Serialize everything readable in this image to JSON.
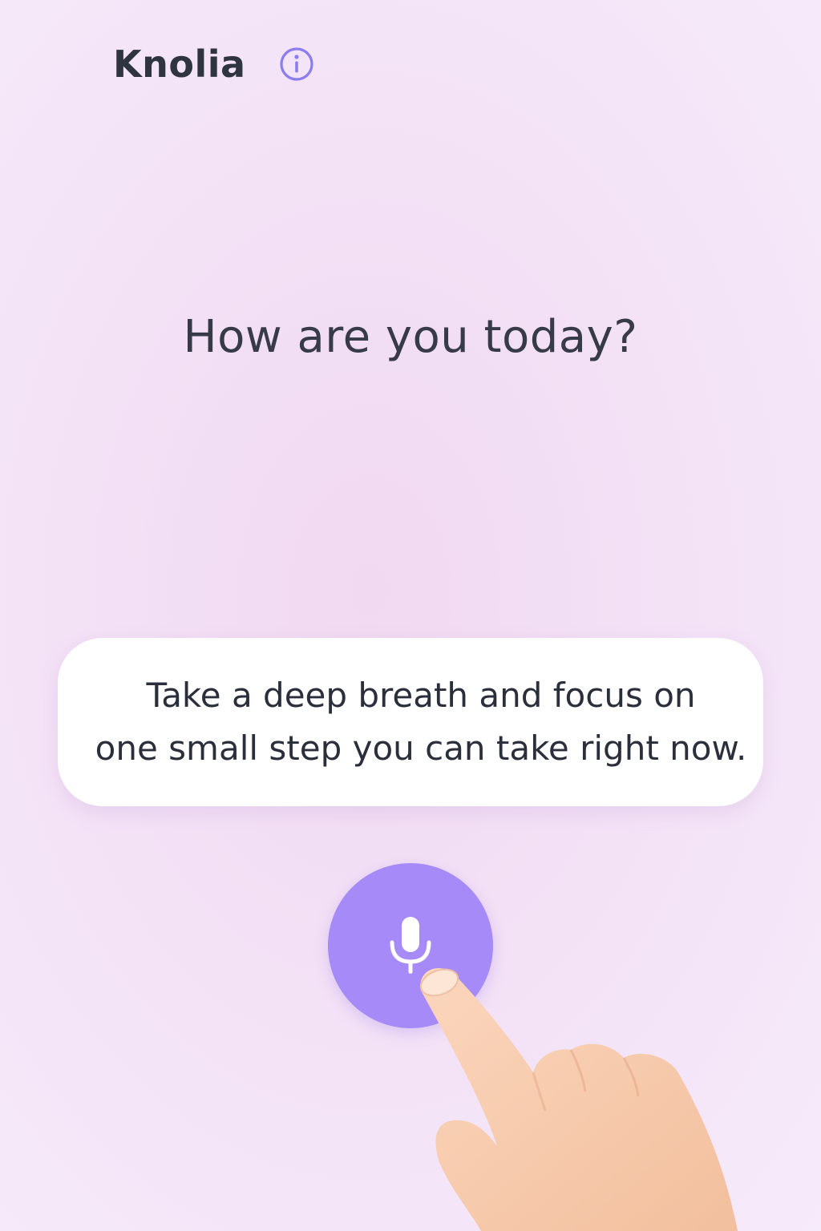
{
  "app": {
    "title": "Knolia"
  },
  "prompt": {
    "question": "How are you today?"
  },
  "suggestion": {
    "line1": "Take a deep breath and focus on",
    "line2": "one small step you can take right now."
  },
  "icons": {
    "info": "info-circle-icon",
    "mic": "microphone-icon",
    "hand": "pointing-hand-illustration"
  },
  "colors": {
    "accent": "#a68af7",
    "info_icon": "#8b7cf0",
    "text_dark": "#2f3441",
    "background": "#f3e1f6",
    "card": "#ffffff"
  }
}
